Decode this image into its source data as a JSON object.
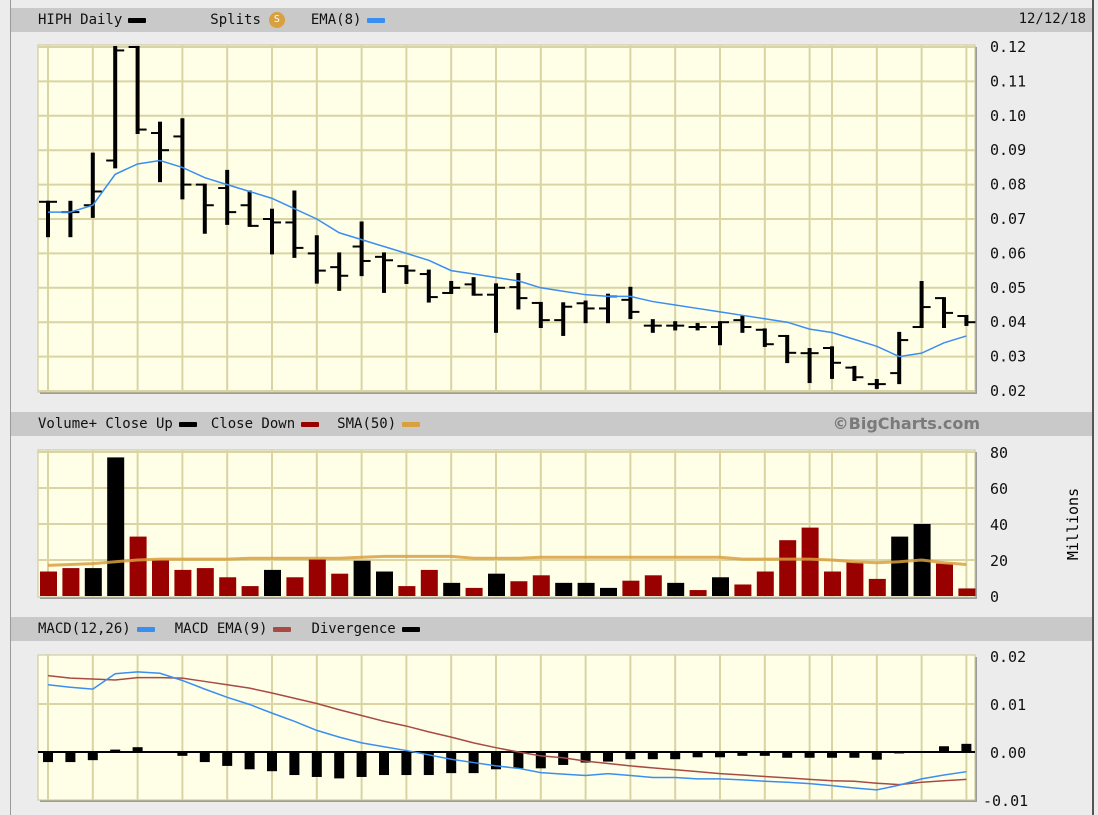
{
  "price_panel": {
    "symbol_label": "HIPH Daily",
    "splits_label": "Splits",
    "splits_icon_letter": "S",
    "ema_label": "EMA(8)",
    "date": "12/12/18"
  },
  "volume_panel": {
    "close_up_label": "Volume+ Close Up",
    "close_down_label": "Close Down",
    "sma_label": "SMA(50)",
    "brand": "©BigCharts.com",
    "unit_label": "Millions"
  },
  "macd_panel": {
    "macd_label": "MACD(12,26)",
    "signal_label": "MACD EMA(9)",
    "divergence_label": "Divergence"
  },
  "colors": {
    "price_bar": "#000000",
    "ema": "#3a8ef0",
    "splits": "#d9a040",
    "volume_up": "#000000",
    "volume_down": "#990000",
    "sma": "#d9a040",
    "macd": "#3a8ef0",
    "signal": "#a84a44",
    "divergence": "#000000",
    "plot_bg": "#ffffe8",
    "grid": "#d9d4a2"
  },
  "chart_data": [
    {
      "type": "ohlc",
      "title": "HIPH Daily",
      "ylim": [
        0.02,
        0.12
      ],
      "yticks": [
        "0.12",
        "0.11",
        "0.10",
        "0.09",
        "0.08",
        "0.07",
        "0.06",
        "0.05",
        "0.04",
        "0.03",
        "0.02"
      ],
      "ohlc": [
        [
          0.075,
          0.075,
          0.065,
          0.075
        ],
        [
          0.072,
          0.075,
          0.065,
          0.072
        ],
        [
          0.074,
          0.089,
          0.0706,
          0.078
        ],
        [
          0.087,
          0.12,
          0.085,
          0.119
        ],
        [
          0.12,
          0.12,
          0.095,
          0.096
        ],
        [
          0.095,
          0.098,
          0.081,
          0.09
        ],
        [
          0.094,
          0.099,
          0.076,
          0.08
        ],
        [
          0.08,
          0.08,
          0.066,
          0.074
        ],
        [
          0.079,
          0.084,
          0.0686,
          0.072
        ],
        [
          0.074,
          0.078,
          0.068,
          0.068
        ],
        [
          0.07,
          0.0727,
          0.06,
          0.069
        ],
        [
          0.069,
          0.078,
          0.059,
          0.0616
        ],
        [
          0.06,
          0.065,
          0.0515,
          0.055
        ],
        [
          0.056,
          0.06,
          0.0494,
          0.0535
        ],
        [
          0.062,
          0.069,
          0.0537,
          0.0578
        ],
        [
          0.059,
          0.06,
          0.0488,
          0.058
        ],
        [
          0.0563,
          0.0563,
          0.0514,
          0.055
        ],
        [
          0.054,
          0.055,
          0.046,
          0.0473
        ],
        [
          0.0485,
          0.0517,
          0.0485,
          0.05
        ],
        [
          0.051,
          0.0528,
          0.048,
          0.048
        ],
        [
          0.048,
          0.051,
          0.0372,
          0.05
        ],
        [
          0.0502,
          0.054,
          0.044,
          0.047
        ],
        [
          0.0456,
          0.0456,
          0.0386,
          0.0406
        ],
        [
          0.0406,
          0.0455,
          0.0363,
          0.0445
        ],
        [
          0.0455,
          0.046,
          0.04,
          0.044
        ],
        [
          0.044,
          0.048,
          0.04,
          0.0475
        ],
        [
          0.0465,
          0.05,
          0.0412,
          0.043
        ],
        [
          0.039,
          0.0406,
          0.0372,
          0.039
        ],
        [
          0.039,
          0.04,
          0.0379,
          0.039
        ],
        [
          0.0386,
          0.0395,
          0.0379,
          0.0386
        ],
        [
          0.0386,
          0.04,
          0.0336,
          0.04
        ],
        [
          0.0406,
          0.0418,
          0.0372,
          0.0386
        ],
        [
          0.0378,
          0.0379,
          0.0331,
          0.0336
        ],
        [
          0.036,
          0.036,
          0.0284,
          0.0311
        ],
        [
          0.031,
          0.0322,
          0.0226,
          0.031
        ],
        [
          0.0325,
          0.0327,
          0.0238,
          0.0282
        ],
        [
          0.0268,
          0.027,
          0.0232,
          0.024
        ],
        [
          0.022,
          0.0232,
          0.0209,
          0.022
        ],
        [
          0.0252,
          0.0369,
          0.0223,
          0.0348
        ],
        [
          0.0386,
          0.0517,
          0.0386,
          0.0444
        ],
        [
          0.047,
          0.047,
          0.0386,
          0.0427
        ],
        [
          0.0418,
          0.0418,
          0.0392,
          0.04
        ]
      ],
      "ema8": [
        0.072,
        0.072,
        0.074,
        0.083,
        0.086,
        0.087,
        0.085,
        0.082,
        0.08,
        0.078,
        0.076,
        0.073,
        0.07,
        0.066,
        0.064,
        0.062,
        0.06,
        0.058,
        0.055,
        0.054,
        0.053,
        0.052,
        0.05,
        0.049,
        0.048,
        0.0475,
        0.0475,
        0.046,
        0.045,
        0.044,
        0.043,
        0.042,
        0.041,
        0.04,
        0.038,
        0.037,
        0.035,
        0.033,
        0.03,
        0.031,
        0.034,
        0.036,
        0.037
      ]
    },
    {
      "type": "bar",
      "title": "Volume+",
      "ylabel": "Millions",
      "ylim": [
        0,
        80
      ],
      "yticks": [
        "80",
        "60",
        "40",
        "20",
        "0"
      ],
      "values": [
        13.6,
        15.5,
        15.5,
        77,
        33,
        20,
        14.5,
        15.5,
        10.4,
        5.5,
        14.5,
        10.4,
        20.5,
        12.4,
        19.6,
        13.6,
        5.5,
        14.5,
        7.3,
        4.5,
        12.4,
        8.2,
        11.5,
        7.3,
        7.3,
        4.5,
        8.5,
        11.5,
        7.3,
        3.3,
        10.4,
        6.4,
        13.6,
        31,
        38,
        13.6,
        18.7,
        9.5,
        33,
        40,
        18,
        4.2
      ],
      "direction": [
        "down",
        "down",
        "up",
        "up",
        "down",
        "down",
        "down",
        "down",
        "down",
        "down",
        "up",
        "down",
        "down",
        "down",
        "up",
        "up",
        "down",
        "down",
        "up",
        "down",
        "up",
        "down",
        "down",
        "up",
        "up",
        "up",
        "down",
        "down",
        "up",
        "down",
        "up",
        "down",
        "down",
        "down",
        "down",
        "down",
        "down",
        "down",
        "up",
        "up",
        "down",
        "down"
      ],
      "sma50": [
        17,
        17.5,
        18,
        19,
        20,
        20.5,
        20.5,
        20.5,
        20.5,
        21,
        21,
        21,
        21,
        21,
        21.5,
        22,
        22,
        22,
        22,
        21,
        21,
        21,
        21.5,
        21.5,
        21.5,
        21.5,
        21.5,
        21.5,
        21.5,
        21.5,
        21.5,
        20.5,
        20.5,
        20.5,
        20.5,
        20,
        19,
        18.5,
        19,
        20,
        18.5,
        17.5
      ]
    },
    {
      "type": "line",
      "title": "MACD(12,26)",
      "units": "0.001",
      "ylim": [
        -0.01,
        0.02
      ],
      "yticks": [
        "0.02",
        "0.01",
        "0.00",
        "-0.01"
      ],
      "macd": [
        14,
        13.5,
        13.1,
        16.3,
        16.7,
        16.4,
        14.9,
        13.1,
        11.4,
        9.9,
        8.1,
        6.4,
        4.5,
        3.1,
        1.9,
        1.1,
        0.3,
        -0.6,
        -1.5,
        -2.2,
        -2.9,
        -3.4,
        -4.3,
        -4.6,
        -4.9,
        -4.5,
        -4.9,
        -5.3,
        -5.3,
        -5.6,
        -5.6,
        -5.8,
        -6.1,
        -6.3,
        -6.6,
        -7,
        -7.5,
        -7.9,
        -6.9,
        -5.6,
        -4.8,
        -4.1
      ],
      "signal": [
        15.9,
        15.4,
        15.2,
        15,
        15.5,
        15.5,
        15.4,
        14.7,
        14,
        13.3,
        12.3,
        11.2,
        10.1,
        8.8,
        7.6,
        6.4,
        5.4,
        4.2,
        3.1,
        1.9,
        0.9,
        0,
        -0.8,
        -1.2,
        -1.9,
        -2.4,
        -2.9,
        -3.3,
        -3.7,
        -4.1,
        -4.5,
        -4.8,
        -5.1,
        -5.4,
        -5.7,
        -6,
        -6.1,
        -6.5,
        -6.8,
        -6.3,
        -6,
        -5.7
      ],
      "divergence": [
        -2.1,
        -2.1,
        -1.7,
        0.5,
        1,
        0,
        -0.8,
        -2.1,
        -2.9,
        -3.6,
        -4,
        -4.8,
        -5.2,
        -5.5,
        -5.2,
        -4.8,
        -4.8,
        -4.8,
        -4.4,
        -4.4,
        -3.6,
        -3.4,
        -3.4,
        -2.7,
        -2.2,
        -2,
        -1.5,
        -1.5,
        -1.5,
        -1.1,
        -1.1,
        -0.8,
        -0.8,
        -1.2,
        -1.2,
        -1.2,
        -1.2,
        -1.6,
        -0.3,
        0.2,
        1.2,
        1.7
      ]
    }
  ]
}
